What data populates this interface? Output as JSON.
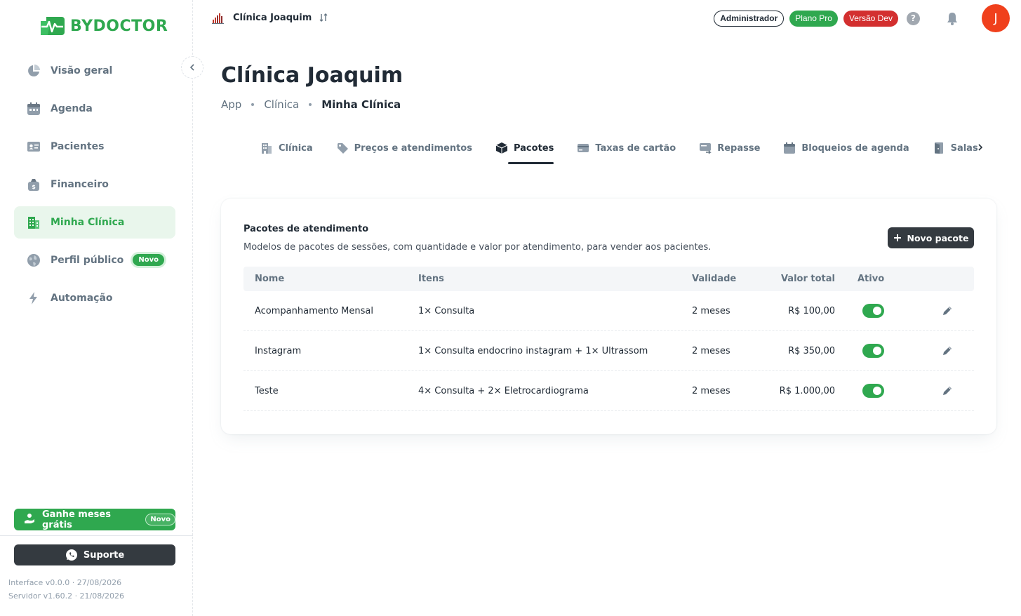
{
  "brand": {
    "name": "BYDOCTOR",
    "color": "#2fa84f"
  },
  "sidebar": {
    "items": [
      {
        "label": "Visão geral",
        "icon": "pie-chart-icon"
      },
      {
        "label": "Agenda",
        "icon": "calendar-icon"
      },
      {
        "label": "Pacientes",
        "icon": "id-card-icon"
      },
      {
        "label": "Financeiro",
        "icon": "money-bag-icon"
      },
      {
        "label": "Minha Clínica",
        "icon": "building-icon",
        "active": true
      },
      {
        "label": "Perfil público",
        "icon": "globe-icon",
        "badge": "Novo"
      },
      {
        "label": "Automação",
        "icon": "lightning-icon"
      }
    ],
    "promo": {
      "label": "Ganhe meses grátis",
      "badge": "Novo"
    },
    "support_label": "Suporte",
    "interface_version": "Interface v0.0.0 · 27/08/2026",
    "server_version": "Servidor v1.60.2 · 21/08/2026"
  },
  "topbar": {
    "clinic_name": "Clínica Joaquim",
    "role": "Administrador",
    "plan": "Plano Pro",
    "env": "Versão Dev",
    "help": "?",
    "avatar_initial": "J"
  },
  "header": {
    "title": "Clínica Joaquim",
    "breadcrumb": [
      "App",
      "Clínica",
      "Minha Clínica"
    ]
  },
  "tabs": [
    {
      "label": "Clínica",
      "icon": "building-icon"
    },
    {
      "label": "Preços e atendimentos",
      "icon": "price-tag-icon"
    },
    {
      "label": "Pacotes",
      "icon": "package-icon",
      "active": true
    },
    {
      "label": "Taxas de cartão",
      "icon": "credit-card-icon"
    },
    {
      "label": "Repasse",
      "icon": "transfer-icon"
    },
    {
      "label": "Bloqueios de agenda",
      "icon": "calendar-icon"
    },
    {
      "label": "Salas",
      "icon": "door-icon"
    }
  ],
  "card": {
    "title": "Pacotes de atendimento",
    "subtitle": "Modelos de pacotes de sessões, com quantidade e valor por atendimento, para vender aos pacientes.",
    "new_button": "Novo pacote",
    "columns": [
      "Nome",
      "Itens",
      "Validade",
      "Valor total",
      "Ativo"
    ],
    "rows": [
      {
        "nome": "Acompanhamento Mensal",
        "itens": "1× Consulta",
        "validade": "2 meses",
        "valor": "R$ 100,00",
        "ativo": true
      },
      {
        "nome": "Instagram",
        "itens": "1× Consulta endocrino instagram + 1× Ultrassom",
        "validade": "2 meses",
        "valor": "R$ 350,00",
        "ativo": true
      },
      {
        "nome": "Teste",
        "itens": "4× Consulta + 2× Eletrocardiograma",
        "validade": "2 meses",
        "valor": "R$ 1.000,00",
        "ativo": true
      }
    ]
  }
}
